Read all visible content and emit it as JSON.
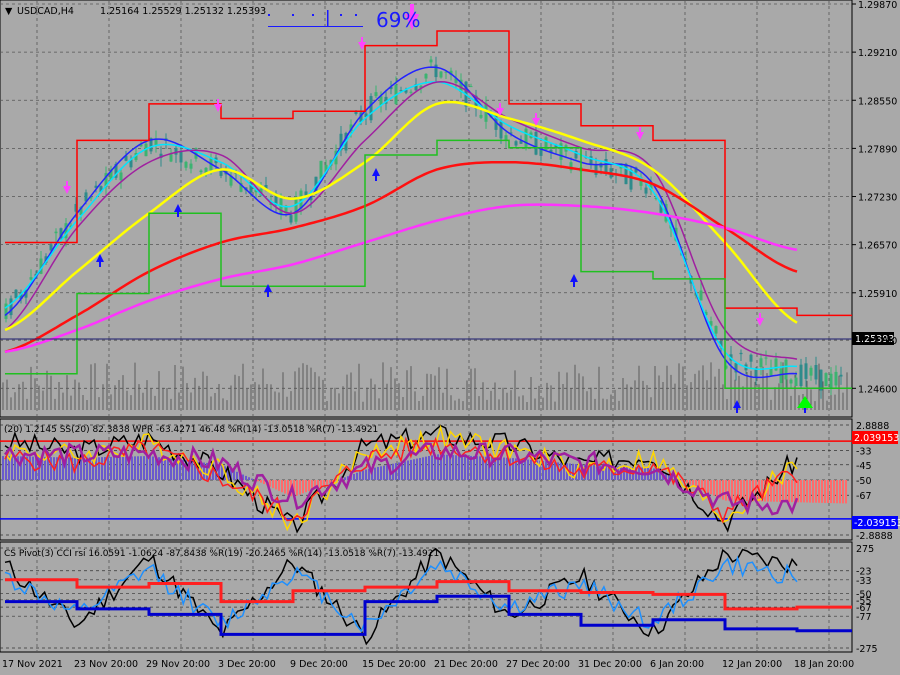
{
  "header": {
    "symbol": "USDCAD,H4",
    "ohlc": "1.25164 1.25529 1.25132 1.25393",
    "probability": "69%"
  },
  "price_axis": {
    "ticks": [
      "1.29870",
      "1.29210",
      "1.28550",
      "1.27890",
      "1.27230",
      "1.26570",
      "1.25910",
      "1.25260",
      "1.24600"
    ],
    "current": "1.25393"
  },
  "panel2": {
    "legend": "(20) 1.2145  SS(20)  82.3838  WPR  -63.4271  46.48  %R(14) -13.0518  %R(7) -13.4921",
    "ticks_right": [
      "2.8888",
      "-33",
      "-45",
      "-50",
      "-67",
      "-2.8888"
    ],
    "badge_top": "2.039153",
    "badge_bottom": "-2.039153"
  },
  "panel3": {
    "legend": "CS Pivot(3)  CCI rsi 16.0591  -1.0624  -87.8438  %R(19) -20.2465  %R(14) -13.0518  %R(7) -13.4921",
    "ticks_right": [
      "275",
      "-23",
      "-33",
      "-50",
      "-55",
      "-67",
      "-77",
      "-275"
    ]
  },
  "time_axis": [
    "17 Nov 2021",
    "23 Nov 20:00",
    "29 Nov 20:00",
    "3 Dec 20:00",
    "9 Dec 20:00",
    "15 Dec 20:00",
    "21 Dec 20:00",
    "27 Dec 20:00",
    "31 Dec 20:00",
    "6 Jan 20:00",
    "12 Jan 20:00",
    "18 Jan 20:00"
  ],
  "chart_data": [
    {
      "type": "line",
      "title": "USDCAD,H4",
      "x": [
        "17 Nov 2021",
        "23 Nov 20:00",
        "29 Nov 20:00",
        "3 Dec 20:00",
        "9 Dec 20:00",
        "15 Dec 20:00",
        "21 Dec 20:00",
        "27 Dec 20:00",
        "31 Dec 20:00",
        "6 Jan 20:00",
        "12 Jan 20:00",
        "18 Jan 20:00"
      ],
      "ylim": [
        1.2433,
        1.2987
      ],
      "current_price": 1.25393,
      "series": [
        {
          "values": [
            1.256,
            1.27,
            1.28,
            1.276,
            1.27,
            1.284,
            1.29,
            1.281,
            1.277,
            1.274,
            1.25,
            1.248
          ],
          "color": "#2222ff"
        },
        {
          "values": [
            1.257,
            1.269,
            1.279,
            1.277,
            1.271,
            1.283,
            1.288,
            1.282,
            1.278,
            1.273,
            1.251,
            1.249
          ],
          "color": "#00e5ff"
        },
        {
          "values": [
            1.254,
            1.268,
            1.277,
            1.278,
            1.27,
            1.28,
            1.288,
            1.283,
            1.279,
            1.276,
            1.254,
            1.25
          ],
          "color": "#a020a0"
        },
        {
          "values": [
            1.254,
            1.262,
            1.27,
            1.276,
            1.272,
            1.277,
            1.285,
            1.283,
            1.28,
            1.276,
            1.266,
            1.255
          ],
          "color": "#ffff00"
        },
        {
          "values": [
            1.251,
            1.256,
            1.262,
            1.266,
            1.268,
            1.271,
            1.276,
            1.277,
            1.276,
            1.274,
            1.268,
            1.262
          ],
          "color": "#ff1010"
        },
        {
          "values": [
            1.251,
            1.254,
            1.258,
            1.261,
            1.263,
            1.266,
            1.269,
            1.271,
            1.271,
            1.27,
            1.268,
            1.265
          ],
          "color": "#ff33ff"
        },
        {
          "values": [
            1.266,
            1.28,
            1.285,
            1.283,
            1.284,
            1.293,
            1.295,
            1.285,
            1.282,
            1.28,
            1.257,
            1.256
          ],
          "color": "#ff0000"
        },
        {
          "values": [
            1.248,
            1.259,
            1.27,
            1.26,
            1.26,
            1.278,
            1.28,
            1.279,
            1.262,
            1.261,
            1.246,
            1.246
          ],
          "color": "#20c020"
        }
      ]
    },
    {
      "type": "line",
      "ylim": [
        -2.8888,
        2.8888
      ],
      "levels": [
        2.039153,
        -2.039153
      ],
      "series": [
        {
          "values": [
            2.0,
            1.5,
            2.2,
            0.5,
            -2.5,
            1.8,
            2.4,
            1.9,
            0.8,
            1.4,
            -2.2,
            1.1
          ],
          "color": "#000000"
        },
        {
          "values": [
            1.6,
            1.3,
            1.9,
            0.6,
            -2.3,
            1.5,
            2.2,
            1.6,
            0.6,
            1.1,
            -2.0,
            0.8
          ],
          "color": "#ffd700"
        },
        {
          "values": [
            1.2,
            0.9,
            1.6,
            0.1,
            -1.9,
            1.1,
            1.9,
            1.3,
            0.4,
            0.8,
            -1.7,
            0.4
          ],
          "color": "#ff2020"
        },
        {
          "values": [
            1.4,
            1.3,
            1.4,
            0.9,
            -1.0,
            0.6,
            1.5,
            1.3,
            0.9,
            0.7,
            -1.2,
            -1.3
          ],
          "color": "#a020a0"
        }
      ]
    },
    {
      "type": "line",
      "ylim": [
        -275,
        275
      ],
      "series": [
        {
          "values": [
            180,
            -150,
            220,
            -200,
            200,
            -210,
            250,
            -100,
            120,
            -190,
            240,
            180
          ],
          "color": "#000000"
        },
        {
          "values": [
            120,
            -100,
            160,
            -150,
            150,
            -160,
            190,
            -60,
            80,
            -140,
            180,
            120
          ],
          "color": "#1e90ff"
        },
        {
          "values": [
            100,
            60,
            80,
            -20,
            40,
            60,
            90,
            40,
            30,
            20,
            -60,
            -50
          ],
          "color": "#ff2020"
        },
        {
          "values": [
            -20,
            -60,
            -90,
            -200,
            -200,
            -20,
            10,
            -90,
            -150,
            -120,
            -170,
            -180
          ],
          "color": "#0000cc"
        }
      ]
    }
  ]
}
